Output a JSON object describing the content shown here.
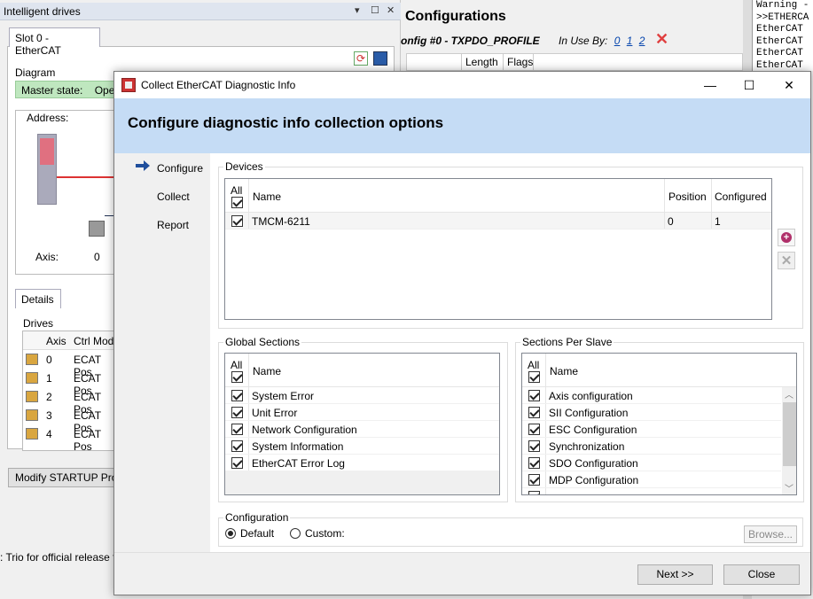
{
  "left_panel": {
    "title": "Intelligent drives",
    "tab": "Slot 0 - EtherCAT",
    "diagram_label": "Diagram",
    "master_state_label": "Master state:",
    "master_state_value": "Ope",
    "address_label": "Address:",
    "axis_label": "Axis:",
    "axis_value": "0",
    "details_tab": "Details",
    "drives_label": "Drives",
    "drives_columns": [
      "Axis",
      "Ctrl Mod"
    ],
    "drives_rows": [
      {
        "axis": "0",
        "mode": "ECAT Pos"
      },
      {
        "axis": "1",
        "mode": "ECAT Pos"
      },
      {
        "axis": "2",
        "mode": "ECAT Pos"
      },
      {
        "axis": "3",
        "mode": "ECAT Pos"
      },
      {
        "axis": "4",
        "mode": "ECAT Pos"
      }
    ],
    "modify_button": "Modify STARTUP Prog",
    "bottom_text": ": Trio for official release f"
  },
  "middle_panel": {
    "title": "Configurations",
    "subtitle": "onfig #0 - TXPDO_PROFILE",
    "in_use_label": "In Use By:",
    "in_use_links": [
      "0",
      "1",
      "2"
    ],
    "columns": [
      "Length",
      "Flags"
    ]
  },
  "console": {
    "lines": [
      "Warning -",
      ">>ETHERCA",
      "EtherCAT",
      "EtherCAT",
      "EtherCAT",
      "EtherCAT"
    ]
  },
  "dialog": {
    "title": "Collect EtherCAT Diagnostic Info",
    "heading": "Configure diagnostic info collection options",
    "nav": {
      "items": [
        "Configure",
        "Collect",
        "Report"
      ],
      "active": "Configure"
    },
    "devices": {
      "legend": "Devices",
      "headers": {
        "all": "All",
        "name": "Name",
        "position": "Position",
        "configured": "Configured"
      },
      "rows": [
        {
          "checked": true,
          "name": "TMCM-6211",
          "position": "0",
          "configured": "1"
        }
      ]
    },
    "global_sections": {
      "legend": "Global Sections",
      "headers": {
        "all": "All",
        "name": "Name"
      },
      "rows": [
        {
          "checked": true,
          "name": "System Error"
        },
        {
          "checked": true,
          "name": "Unit Error"
        },
        {
          "checked": true,
          "name": "Network Configuration"
        },
        {
          "checked": true,
          "name": "System Information"
        },
        {
          "checked": true,
          "name": "EtherCAT Error Log"
        }
      ]
    },
    "sections_per_slave": {
      "legend": "Sections Per Slave",
      "headers": {
        "all": "All",
        "name": "Name"
      },
      "rows": [
        {
          "checked": true,
          "name": "Axis configuration"
        },
        {
          "checked": true,
          "name": "SII Configuration"
        },
        {
          "checked": true,
          "name": "ESC Configuration"
        },
        {
          "checked": true,
          "name": "Synchronization"
        },
        {
          "checked": true,
          "name": "SDO Configuration"
        },
        {
          "checked": true,
          "name": "MDP Configuration"
        }
      ]
    },
    "configuration": {
      "legend": "Configuration",
      "default_label": "Default",
      "custom_label": "Custom:",
      "selected": "Default",
      "browse_button": "Browse..."
    },
    "buttons": {
      "next": "Next >>",
      "close": "Close"
    }
  }
}
